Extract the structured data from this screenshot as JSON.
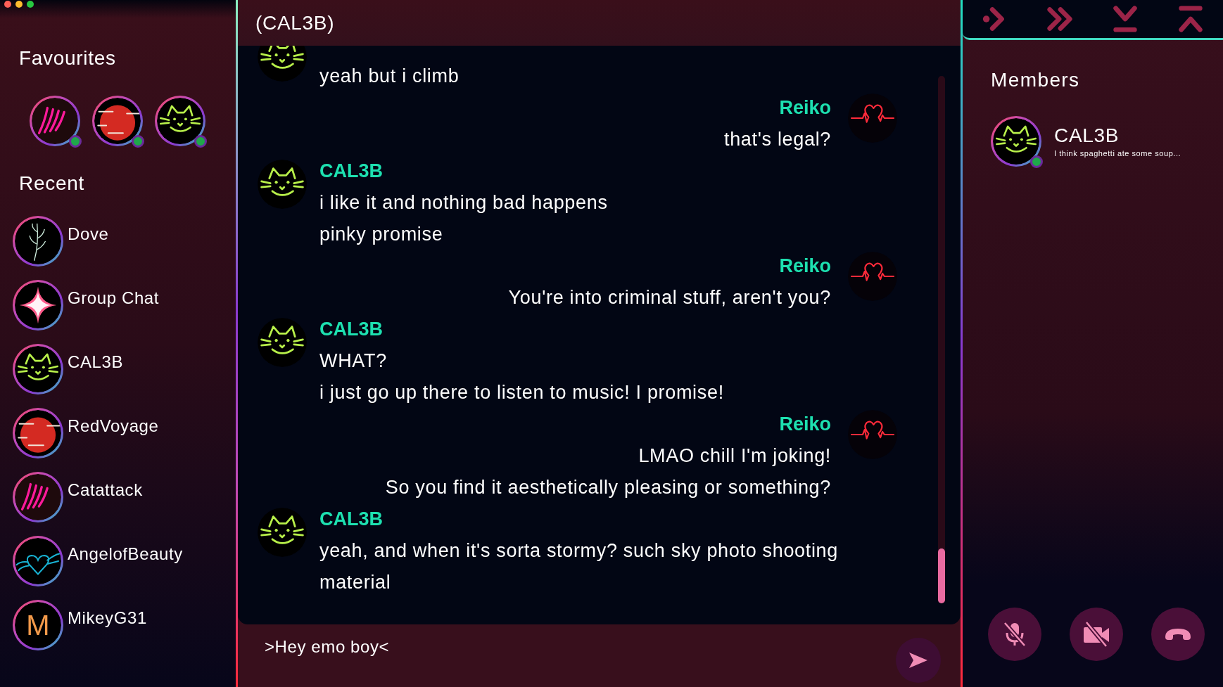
{
  "sidebar": {
    "favourites_title": "Favourites",
    "favourites": [
      {
        "kind": "claw",
        "online": true
      },
      {
        "kind": "moon",
        "online": true
      },
      {
        "kind": "cat",
        "online": true
      }
    ],
    "recent_title": "Recent",
    "recent": [
      {
        "name": "Dove",
        "kind": "plant"
      },
      {
        "name": "Group Chat",
        "kind": "sparkle"
      },
      {
        "name": "CAL3B",
        "kind": "cat"
      },
      {
        "name": "RedVoyage",
        "kind": "moon"
      },
      {
        "name": "Catattack",
        "kind": "claw"
      },
      {
        "name": "AngelofBeauty",
        "kind": "wings"
      },
      {
        "name": "MikeyG31",
        "kind": "letter",
        "initial": "M"
      }
    ]
  },
  "chat": {
    "title": "(CAL3B)",
    "messages": [
      {
        "kind": "received",
        "lines": [
          "yeah but i climb"
        ]
      },
      {
        "kind": "sent",
        "author": "Reiko",
        "lines": [
          "that's legal?"
        ]
      },
      {
        "kind": "received",
        "author": "CAL3B",
        "lines": [
          "i like it and nothing bad happens",
          "pinky promise"
        ]
      },
      {
        "kind": "sent",
        "author": "Reiko",
        "lines": [
          "You're into criminal stuff, aren't you?"
        ]
      },
      {
        "kind": "received",
        "author": "CAL3B",
        "lines": [
          "WHAT?",
          "i just go up there to listen to music! I promise!"
        ]
      },
      {
        "kind": "sent",
        "author": "Reiko",
        "lines": [
          "LMAO chill I'm joking!",
          "So you find it aesthetically pleasing or something?"
        ]
      },
      {
        "kind": "received",
        "author": "CAL3B",
        "lines": [
          "yeah, and when it's sorta stormy? such sky photo shooting",
          "material"
        ]
      }
    ],
    "input": {
      "value": ">Hey emo boy<"
    }
  },
  "members": {
    "title": "Members",
    "list": [
      {
        "name": "CAL3B",
        "status": "I think spaghetti ate some soup...",
        "kind": "cat",
        "online": true
      }
    ]
  }
}
